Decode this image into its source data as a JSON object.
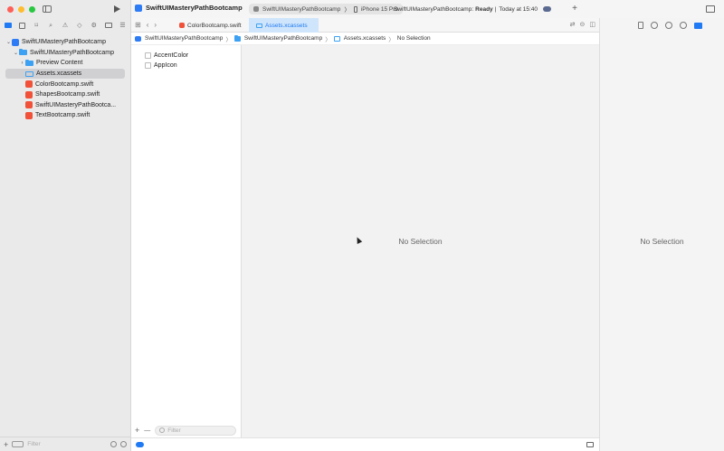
{
  "window": {
    "project_title": "SwiftUIMasteryPathBootcamp"
  },
  "toolbar": {
    "scheme_name": "SwiftUIMasteryPathBootcamp",
    "scheme_separator": "〉",
    "device_name": "iPhone 15 Pro",
    "status_prefix": "SwiftUIMasteryPathBootcamp:",
    "status_state": "Ready",
    "status_separator": "|",
    "status_time": "Today at 15:40",
    "add_tab_label": "+"
  },
  "navigator": {
    "items": [
      {
        "label": "SwiftUIMasteryPathBootcamp",
        "type": "project",
        "expanded": true,
        "indent": 0
      },
      {
        "label": "SwiftUIMasteryPathBootcamp",
        "type": "folder",
        "expanded": true,
        "indent": 1
      },
      {
        "label": "Preview Content",
        "type": "folder",
        "expanded": false,
        "indent": 2
      },
      {
        "label": "Assets.xcassets",
        "type": "assets",
        "indent": 2,
        "selected": true
      },
      {
        "label": "ColorBootcamp.swift",
        "type": "swift",
        "indent": 2
      },
      {
        "label": "ShapesBootcamp.swift",
        "type": "swift",
        "indent": 2
      },
      {
        "label": "SwiftUIMasteryPathBootca...",
        "type": "swift",
        "indent": 2
      },
      {
        "label": "TextBootcamp.swift",
        "type": "swift",
        "indent": 2
      }
    ],
    "filter_placeholder": "Filter",
    "add_label": "+"
  },
  "tabs": [
    {
      "label": "ColorBootcamp.swift",
      "active": false
    },
    {
      "label": "Assets.xcassets",
      "active": true
    }
  ],
  "jumpbar": {
    "items": [
      "SwiftUIMasteryPathBootcamp",
      "SwiftUIMasteryPathBootcamp",
      "Assets.xcassets",
      "No Selection"
    ],
    "separator": "〉"
  },
  "assets": {
    "items": [
      "AccentColor",
      "AppIcon"
    ],
    "add_label": "+",
    "remove_label": "—",
    "filter_placeholder": "Filter"
  },
  "editor": {
    "empty_text": "No Selection"
  },
  "inspector": {
    "empty_text": "No Selection"
  },
  "colors": {
    "accent": "#1f7af3",
    "swift_icon": "#f05138",
    "folder_icon": "#3da1f3",
    "close": "#fe5f57",
    "minimize": "#febc2e",
    "zoom": "#28c840"
  }
}
